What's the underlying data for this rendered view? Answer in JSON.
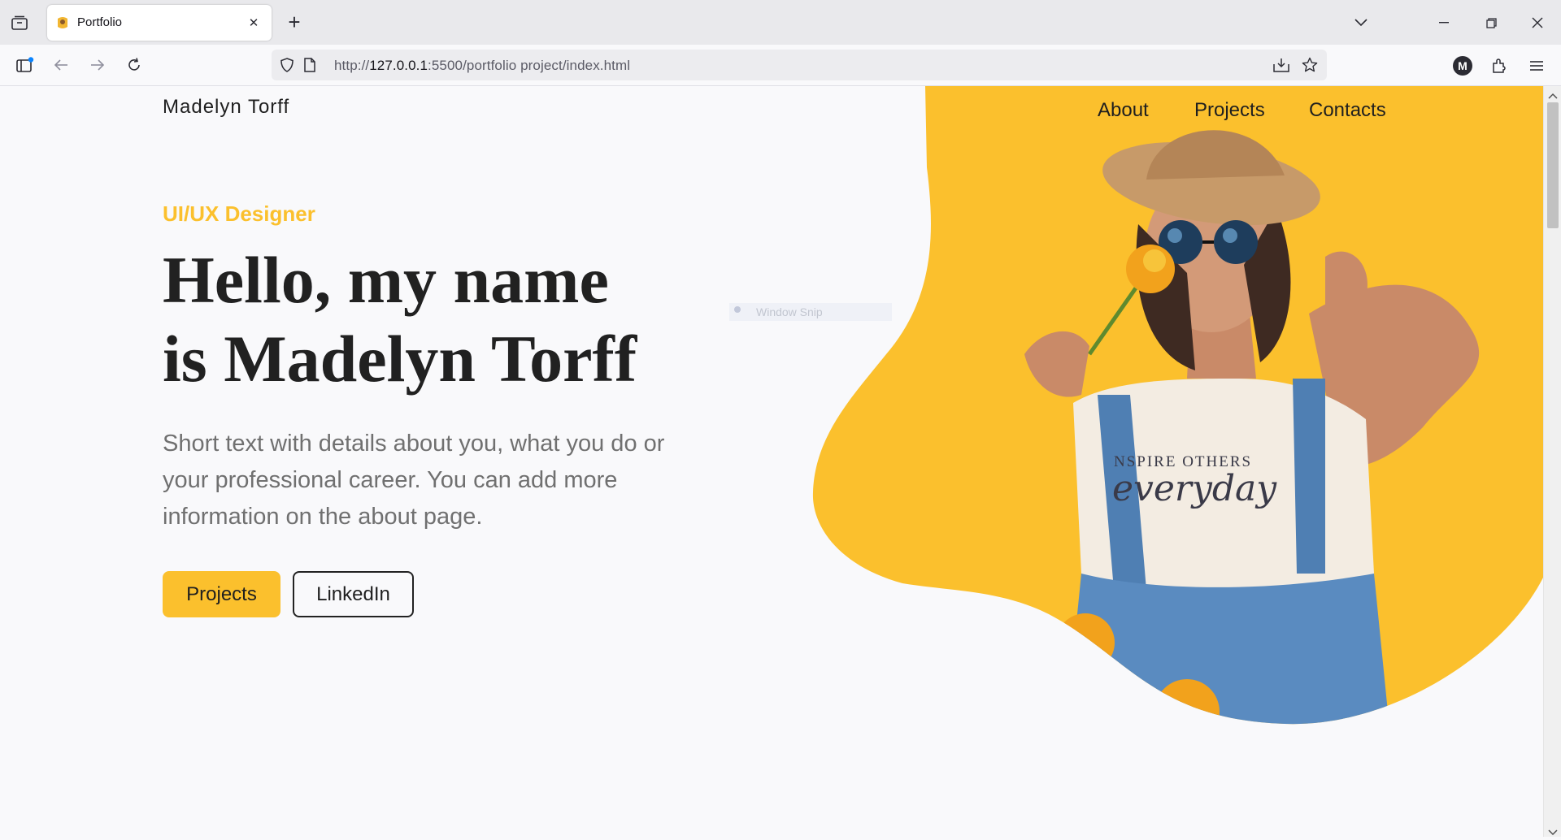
{
  "browser": {
    "tab_title": "Portfolio",
    "url_prefix": "http://",
    "url_host": "127.0.0.1",
    "url_rest": ":5500/portfolio project/index.html",
    "account_initial": "M",
    "new_tab_symbol": "+",
    "close_symbol": "✕"
  },
  "page": {
    "brand": "Madelyn Torff",
    "nav": [
      "About",
      "Projects",
      "Contacts"
    ],
    "role": "UI/UX Designer",
    "headline_line1": "Hello, my name",
    "headline_line2": "is Madelyn Torff",
    "intro": "Short text with details about you, what you do or your professional career. You can add more information on the about page.",
    "buttons": {
      "primary": "Projects",
      "secondary": "LinkedIn"
    },
    "snip_overlay": "Window Snip",
    "shirt_text_1": "NSPIRE OTHERS",
    "shirt_text_2": "everyday"
  },
  "colors": {
    "accent": "#fbc02d",
    "text": "#212121",
    "muted": "#707070",
    "background": "#f9f9fb"
  },
  "icons": [
    "tab-list-icon",
    "favicon",
    "tab-close-icon",
    "new-tab-icon",
    "list-all-tabs-icon",
    "minimize-icon",
    "restore-icon",
    "window-close-icon",
    "sidebar-icon",
    "back-icon",
    "forward-icon",
    "reload-icon",
    "shield-icon",
    "page-icon",
    "download-icon",
    "bookmark-star-icon",
    "account-icon",
    "extensions-icon",
    "menu-icon"
  ]
}
